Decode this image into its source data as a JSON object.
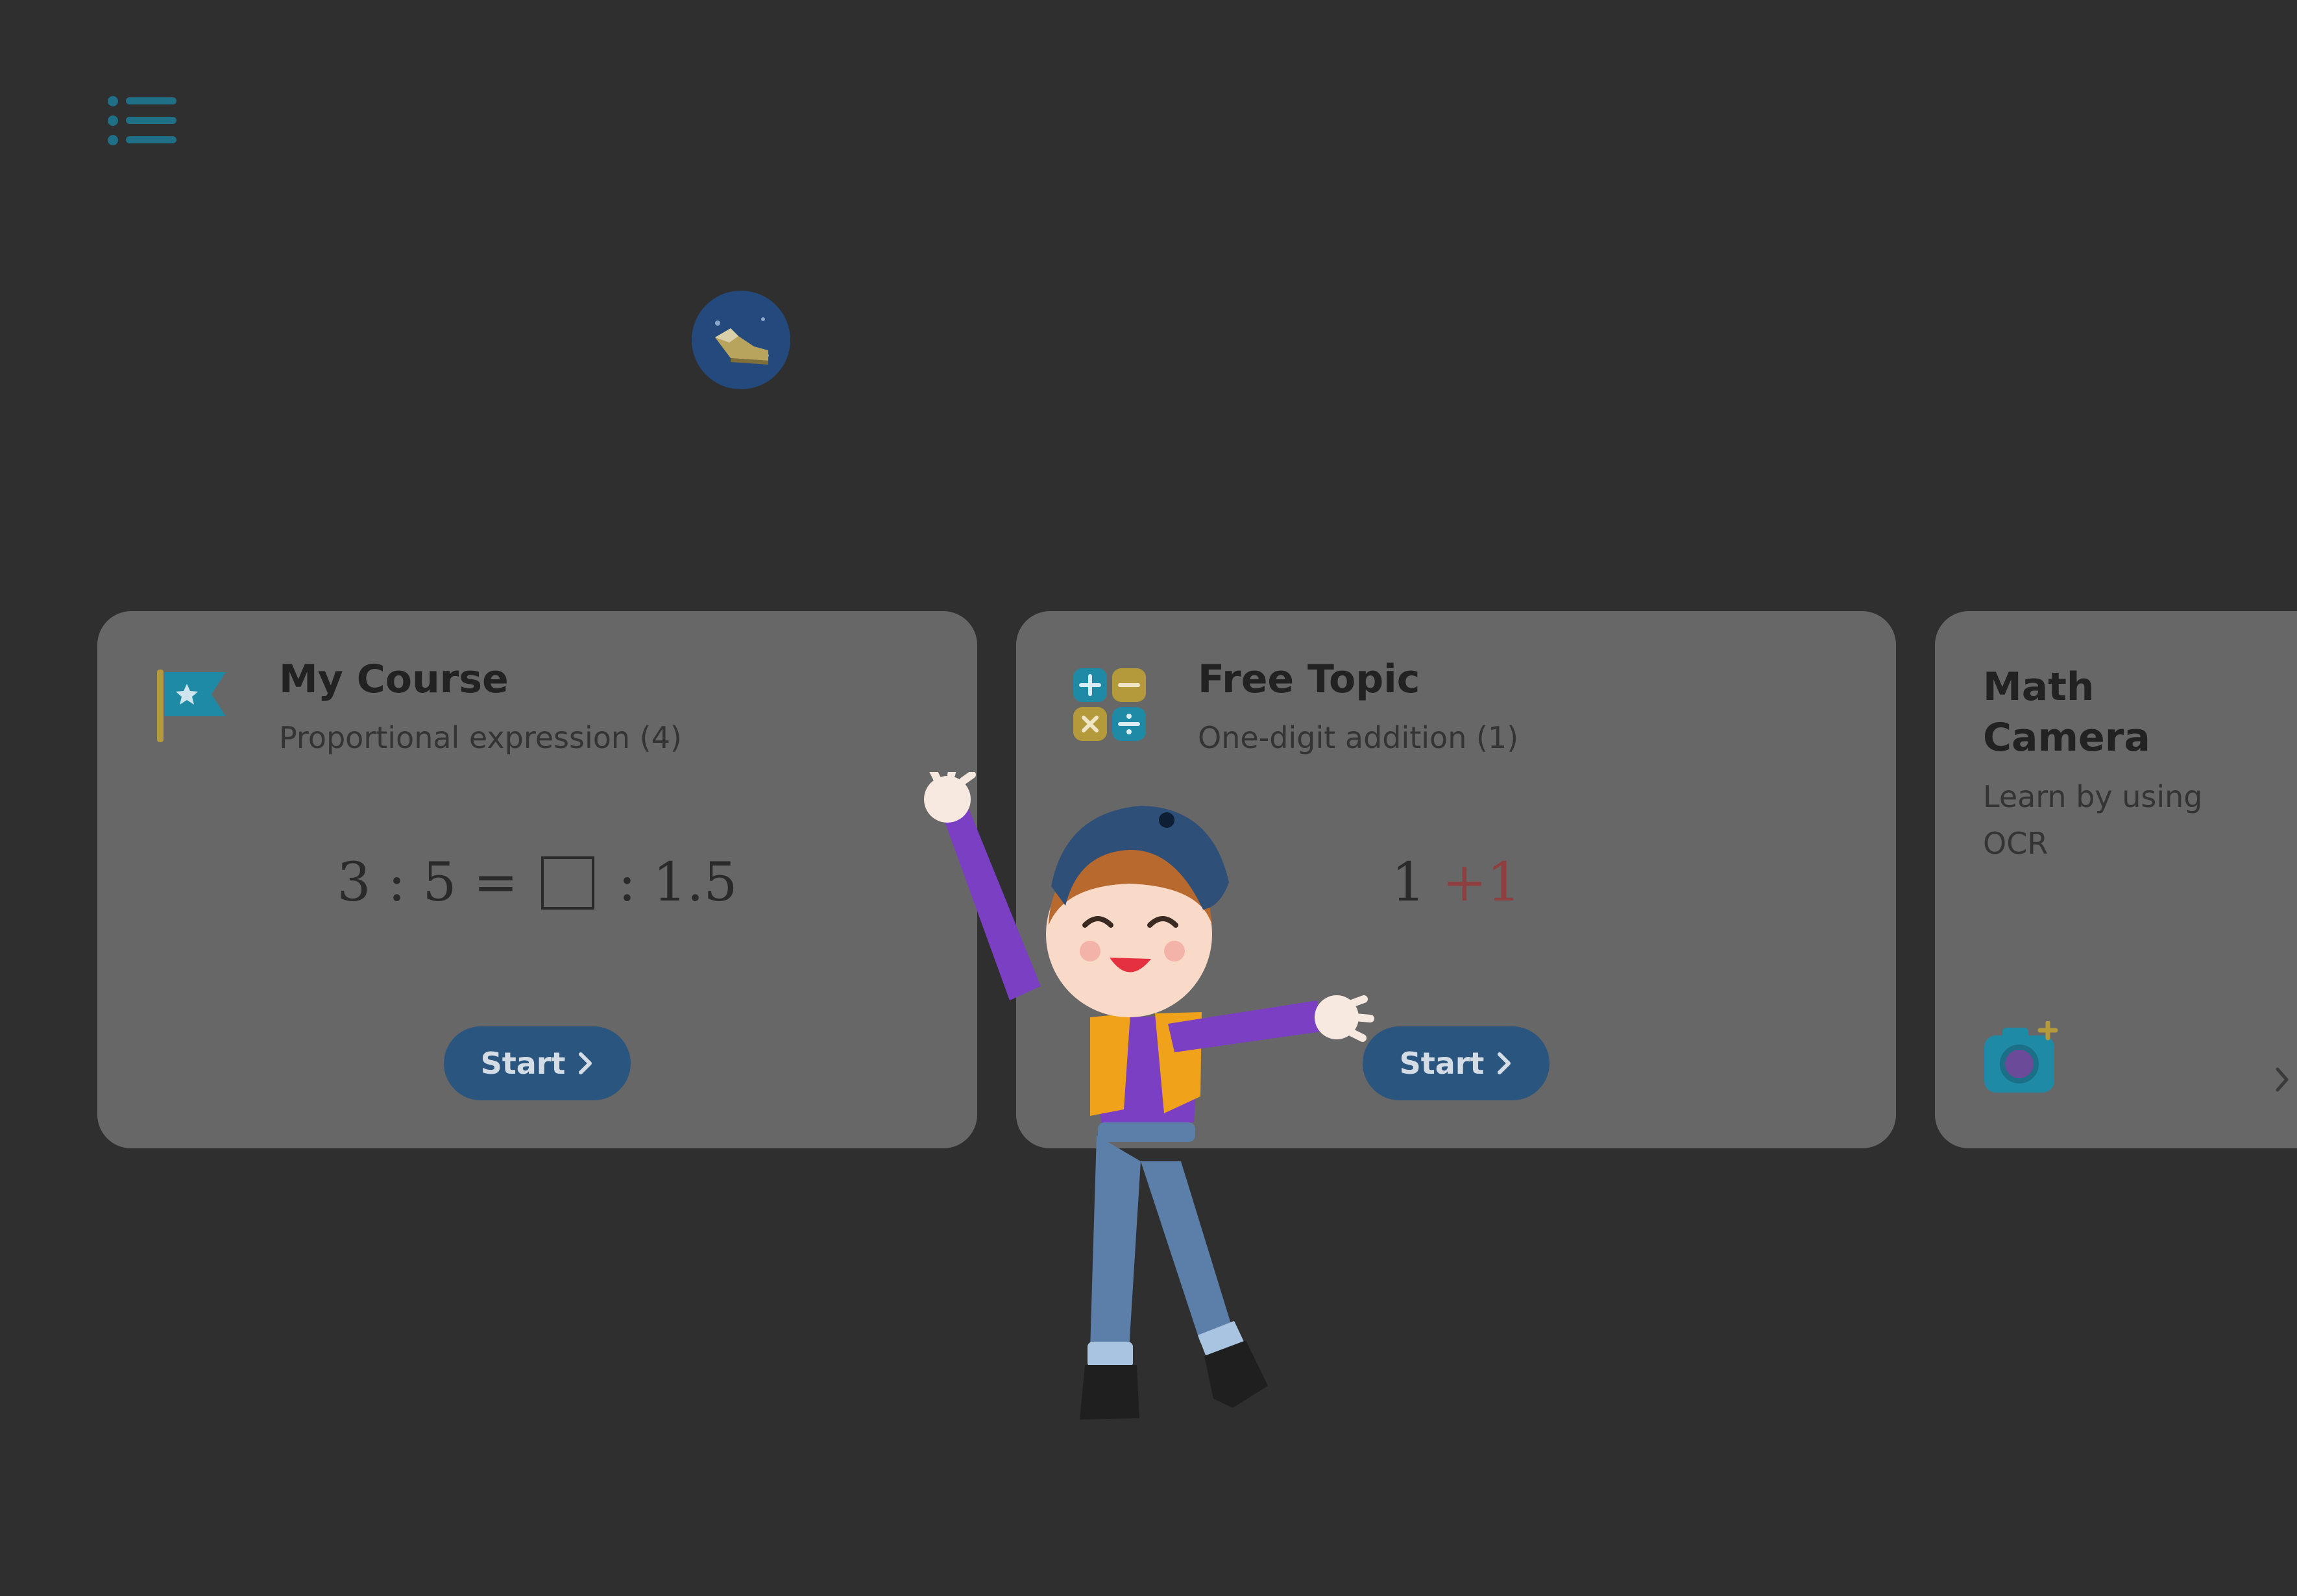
{
  "header": {
    "menu_icon": "list-menu-icon",
    "badge_icon": "shoe-achievement-icon"
  },
  "cards": [
    {
      "title": "My Course",
      "subtitle": "Proportional expression (4)",
      "icon": "flag-star-icon",
      "problem": {
        "a": "3",
        "sep1": ":",
        "b": "5",
        "eq": "=",
        "sep2": ":",
        "c": "1.5"
      },
      "start_label": "Start"
    },
    {
      "title": "Free Topic",
      "subtitle": "One-digit addition (1)",
      "icon": "four-operations-icon",
      "problem": {
        "a": "1",
        "op": "+",
        "b": "1"
      },
      "start_label": "Start"
    },
    {
      "title": "Math Camera",
      "subtitle": "Learn by using OCR",
      "icon": "camera-plus-icon"
    }
  ],
  "mascot": {
    "icon": "boy-mascot"
  },
  "colors": {
    "background": "#2f2f2f",
    "card": "#676767",
    "button": "#2a557f",
    "accent_teal": "#1f8aa6",
    "accent_gold": "#b59a3c"
  }
}
